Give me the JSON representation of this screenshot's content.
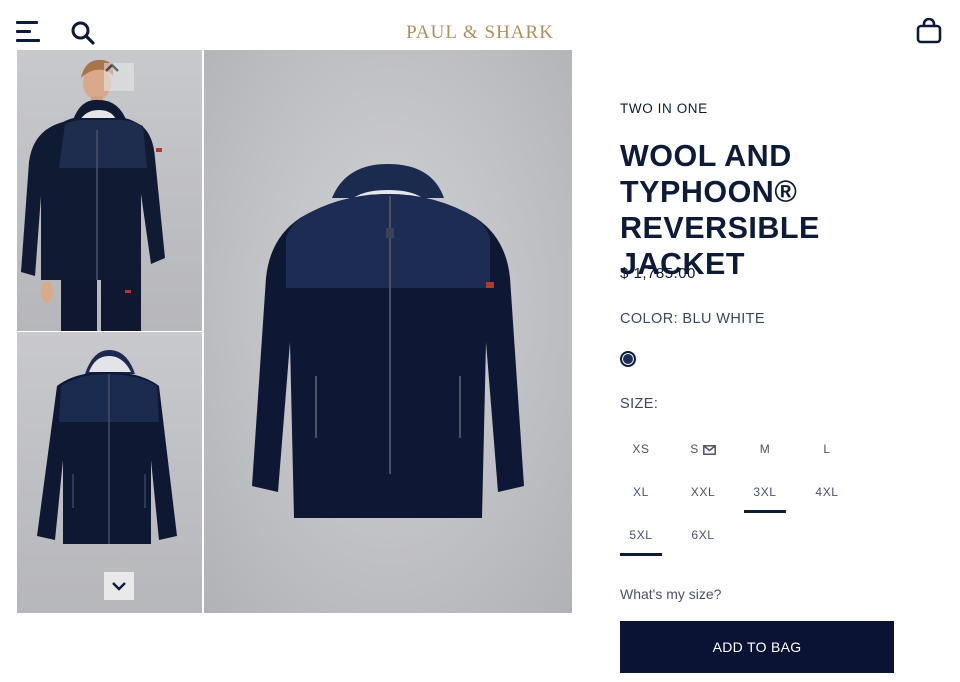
{
  "header": {
    "brand": "PAUL & SHARK",
    "icons": {
      "menu": "menu-icon",
      "search": "search-icon",
      "bag": "shopping-bag-icon"
    }
  },
  "gallery": {
    "thumbnails": [
      {
        "alt": "model-wearing-jacket"
      },
      {
        "alt": "jacket-front-view"
      }
    ],
    "nav_up_icon": "chevron-up-icon",
    "nav_down_icon": "chevron-down-icon",
    "main_image": "jacket-front-view"
  },
  "product": {
    "eyebrow": "TWO IN ONE",
    "title": "WOOL AND TYPHOON® REVERSIBLE JACKET",
    "price": "$ 1,785.00",
    "color_label": "COLOR: BLU WHITE",
    "swatch_color": "#1c2d5c",
    "size_label": "SIZE:",
    "sizes": [
      {
        "label": "XS",
        "selected": false
      },
      {
        "label": "S",
        "selected": false,
        "notify": true
      },
      {
        "label": "M",
        "selected": false
      },
      {
        "label": "L",
        "selected": false
      },
      {
        "label": "XL",
        "selected": false
      },
      {
        "label": "XXL",
        "selected": false
      },
      {
        "label": "3XL",
        "selected": true
      },
      {
        "label": "4XL",
        "selected": false
      },
      {
        "label": "5XL",
        "selected": true
      },
      {
        "label": "6XL",
        "selected": false
      }
    ],
    "size_guide_link": "What's my size?",
    "add_to_bag": "ADD TO BAG"
  },
  "colors": {
    "navy": "#0a1333",
    "brand_gold": "#b08f5e",
    "text": "#0d1a38"
  }
}
